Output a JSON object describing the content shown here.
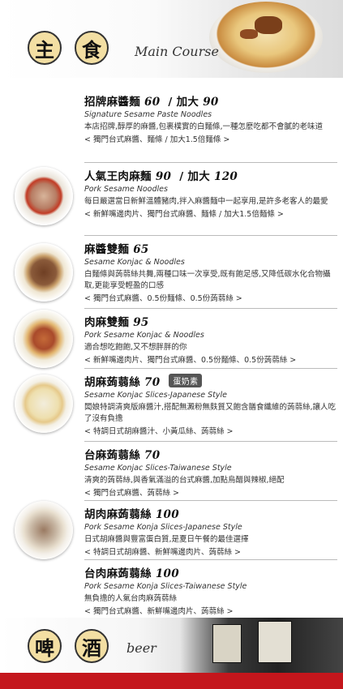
{
  "header": {
    "circle_1": "主",
    "circle_2": "食",
    "english": "Main Course"
  },
  "items": [
    {
      "name": "招牌麻醬麵",
      "price": "60",
      "large_label": "/ 加大",
      "large_price": "90",
      "english": "Signature Sesame Paste Noodles",
      "desc": "本店招牌,醇厚的麻醬,包裹樸實的白麵條,一種怎麼吃都不會膩的老味道",
      "options": "< 獨門台式麻醬、麵條 / 加大1.5倍麵條 >"
    },
    {
      "name": "人氣王肉麻麵",
      "price": "90",
      "large_label": "/ 加大",
      "large_price": "120",
      "english": "Pork Sesame Noodles",
      "desc": "每日嚴選當日新鮮溫體豬肉,拌入麻醬麵中一起享用,是許多老客人的最愛",
      "options": "< 新鮮嘴邊肉片、獨門台式麻醬、麵條 / 加大1.5倍麵條 >"
    },
    {
      "name": "麻醬雙麵",
      "price": "65",
      "english": "Sesame Konjac & Noodles",
      "desc": "白麵條與蒟蒻絲共舞,兩種口味一次享受,既有飽足感,又降低碳水化合物攝取,更能享受輕盈的口感",
      "options": "< 獨門台式麻醬、0.5份麵條、0.5份蒟蒻絲 >"
    },
    {
      "name": "肉麻雙麵",
      "price": "95",
      "english": "Pork Sesame Konjac & Noodles",
      "desc": "適合想吃飽飽,又不想胖胖的你",
      "options": "< 新鮮嘴邊肉片、獨門台式麻醬、0.5份麵條、0.5份蒟蒻絲 >"
    },
    {
      "name": "胡麻蒟蒻絲",
      "price": "70",
      "tag": "蛋奶素",
      "english": "Sesame Konjac Slices-Japanese Style",
      "desc": "闆娘特調清爽版麻醬汁,搭配無澱粉無麩質又飽含膳食纖維的蒟蒻絲,讓人吃了沒有負擔",
      "options": "< 特調日式胡麻醬汁、小黃瓜絲、蒟蒻絲 >"
    },
    {
      "name": "台麻蒟蒻絲",
      "price": "70",
      "english": "Sesame Konjac Slices-Taiwanese Style",
      "desc": "清爽的蒟蒻絲,與香氣滿溢的台式麻醬,加點烏醋與辣椒,絕配",
      "options": "< 獨門台式麻醬、蒟蒻絲 >"
    },
    {
      "name": "胡肉麻蒟蒻絲",
      "price": "100",
      "english": "Pork Sesame Konja Slices-Japanese Style",
      "desc": "日式胡麻醬與豐富蛋白質,是夏日午餐的最佳選擇",
      "options": "< 特調日式胡麻醬、新鮮嘴邊肉片、蒟蒻絲 >"
    },
    {
      "name": "台肉麻蒟蒻絲",
      "price": "100",
      "english": "Pork Sesame Konja Slices-Taiwanese Style",
      "desc": "無負擔的人氣台肉麻蒟蒻絲",
      "options": "< 獨門台式麻醬、新鮮嘴邊肉片、蒟蒻絲 >"
    }
  ],
  "footer": {
    "circle_1": "啤",
    "circle_2": "酒",
    "english": "beer"
  },
  "colors": {
    "circle_fill": "#f3dfa3",
    "accent_red": "#c4161c",
    "tag_bg": "#555555"
  }
}
